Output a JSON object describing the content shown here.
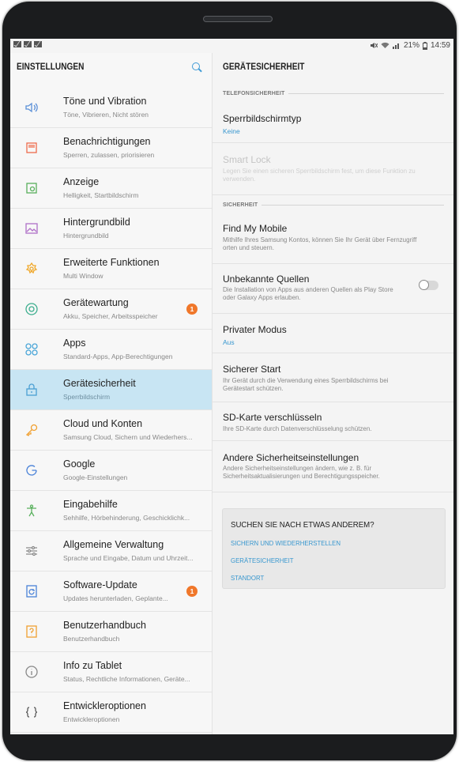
{
  "status_bar": {
    "battery": "21%",
    "time": "14:59"
  },
  "left_pane": {
    "title": "EINSTELLUNGEN",
    "items": [
      {
        "title": "Töne und Vibration",
        "subtitle": "Töne, Vibrieren, Nicht stören",
        "icon": "speaker-icon",
        "color": "#5a8fd8"
      },
      {
        "title": "Benachrichtigungen",
        "subtitle": "Sperren, zulassen, priorisieren",
        "icon": "notification-icon",
        "color": "#ee6b4d"
      },
      {
        "title": "Anzeige",
        "subtitle": "Helligkeit, Startbildschirm",
        "icon": "display-icon",
        "color": "#58b05c"
      },
      {
        "title": "Hintergrundbild",
        "subtitle": "Hintergrundbild",
        "icon": "wallpaper-icon",
        "color": "#b070c8"
      },
      {
        "title": "Erweiterte Funktionen",
        "subtitle": "Multi Window",
        "icon": "advanced-features-icon",
        "color": "#f0a82a"
      },
      {
        "title": "Gerätewartung",
        "subtitle": "Akku, Speicher, Arbeitsspeicher",
        "icon": "device-maintenance-icon",
        "color": "#3dae8e",
        "badge": "1"
      },
      {
        "title": "Apps",
        "subtitle": "Standard-Apps, App-Berechtigungen",
        "icon": "apps-icon",
        "color": "#4aa6d8"
      },
      {
        "title": "Gerätesicherheit",
        "subtitle": "Sperrbildschirm",
        "icon": "lock-icon",
        "color": "#4a9fd3",
        "selected": true
      },
      {
        "title": "Cloud und Konten",
        "subtitle": "Samsung Cloud, Sichern und Wiederhers...",
        "icon": "key-icon",
        "color": "#f0a030"
      },
      {
        "title": "Google",
        "subtitle": "Google-Einstellungen",
        "icon": "google-icon",
        "color": "#4a82d8"
      },
      {
        "title": "Eingabehilfe",
        "subtitle": "Sehhilfe, Hörbehinderung, Geschicklichk...",
        "icon": "accessibility-icon",
        "color": "#58b05c"
      },
      {
        "title": "Allgemeine Verwaltung",
        "subtitle": "Sprache und Eingabe, Datum und Uhrzeit...",
        "icon": "sliders-icon",
        "color": "#8a8a8a"
      },
      {
        "title": "Software-Update",
        "subtitle": "Updates herunterladen, Geplante...",
        "icon": "software-update-icon",
        "color": "#4a82d8",
        "badge": "1"
      },
      {
        "title": "Benutzerhandbuch",
        "subtitle": "Benutzerhandbuch",
        "icon": "user-manual-icon",
        "color": "#f0a030"
      },
      {
        "title": "Info zu Tablet",
        "subtitle": "Status, Rechtliche Informationen, Geräte...",
        "icon": "info-icon",
        "color": "#888888"
      },
      {
        "title": "Entwickleroptionen",
        "subtitle": "Entwickleroptionen",
        "icon": "developer-options-icon",
        "color": "#555555"
      }
    ]
  },
  "right_pane": {
    "title": "GERÄTESICHERHEIT",
    "section_phone": "TELEFONSICHERHEIT",
    "lock_type": {
      "title": "Sperrbildschirmtyp",
      "value": "Keine"
    },
    "smart_lock": {
      "title": "Smart Lock",
      "subtitle": "Legen Sie einen sicheren Sperrbildschirm fest, um diese Funktion zu verwenden."
    },
    "section_security": "SICHERHEIT",
    "find_my_mobile": {
      "title": "Find My Mobile",
      "subtitle": "Mithilfe Ihres Samsung Kontos, können Sie Ihr Gerät über Fernzugriff orten und steuern."
    },
    "unknown_sources": {
      "title": "Unbekannte Quellen",
      "subtitle": "Die Installation von Apps aus anderen Quellen als Play Store oder Galaxy Apps erlauben.",
      "enabled": false
    },
    "private_mode": {
      "title": "Privater Modus",
      "value": "Aus"
    },
    "secure_start": {
      "title": "Sicherer Start",
      "subtitle": "Ihr Gerät durch die Verwendung eines Sperrbildschirms bei Gerätestart schützen."
    },
    "sd_encrypt": {
      "title": "SD-Karte verschlüsseln",
      "subtitle": "Ihre SD-Karte durch Datenverschlüsselung schützen."
    },
    "other_security": {
      "title": "Andere Sicherheitseinstellungen",
      "subtitle": "Andere Sicherheitseinstellungen ändern, wie z. B. für Sicherheitsaktualisierungen und Berechtigungsspeicher."
    },
    "suggestions": {
      "heading": "SUCHEN SIE NACH ETWAS ANDEREM?",
      "links": [
        "SICHERN UND WIEDERHERSTELLEN",
        "GERÄTESICHERHEIT",
        "STANDORT"
      ]
    }
  },
  "colors": {
    "accent": "#3897cf",
    "selected_bg": "#c8e5f3",
    "badge": "#f0772a"
  }
}
